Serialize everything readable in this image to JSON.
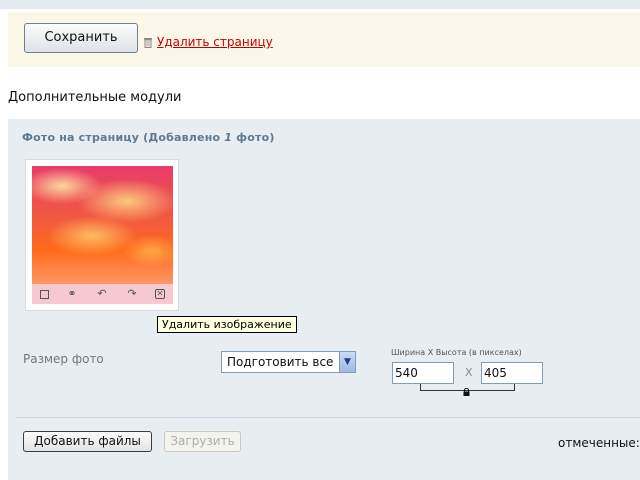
{
  "toolbar": {
    "save_label": "Сохранить",
    "delete_page_label": "Удалить страницу"
  },
  "section": {
    "title": "Дополнительные модули"
  },
  "photo_panel": {
    "title_prefix": "Фото на страницу (Добавлено ",
    "count": "1",
    "title_suffix": " фото)",
    "tooltip": "Удалить изображение",
    "tools": [
      "checkbox-icon",
      "link-icon",
      "rotate-left-icon",
      "rotate-right-icon",
      "delete-icon"
    ]
  },
  "size": {
    "label": "Размер фото",
    "select_value": "Подготовить все",
    "dims_label": "Ширина X Высота (в пикселах)",
    "width": "540",
    "height": "405",
    "separator": "X"
  },
  "actions": {
    "add_files_label": "Добавить файлы",
    "upload_label": "Загрузить",
    "marked_label": "отмеченные:"
  },
  "colors": {
    "delete_link": "#c40000",
    "panel_bg": "#e8edf2",
    "savebar_bg": "#fbf8ea"
  }
}
